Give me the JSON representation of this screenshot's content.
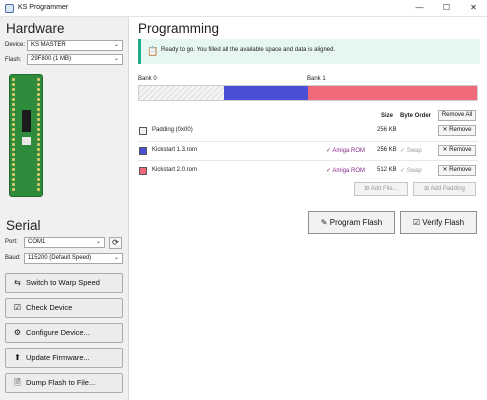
{
  "window": {
    "title": "KS Programmer",
    "controls": {
      "minimize": "—",
      "maximize": "☐",
      "close": "✕"
    }
  },
  "hardware": {
    "heading": "Hardware",
    "device_label": "Device:",
    "device_value": "KS MASTER",
    "flash_label": "Flash:",
    "flash_value": "29F800 (1 MB)"
  },
  "serial": {
    "heading": "Serial",
    "port_label": "Port:",
    "port_value": "COM1",
    "baud_label": "Baud:",
    "baud_value": "115200 (Default Speed)"
  },
  "buttons": {
    "warp": "Switch to Warp Speed",
    "check": "Check Device",
    "configure": "Configure Device...",
    "update": "Update Firmware...",
    "dump": "Dump Flash to File..."
  },
  "programming": {
    "heading": "Programming",
    "info": "Ready to go. You filled all the available space and data is aligned.",
    "bank0": "Bank 0",
    "bank1": "Bank 1",
    "col_size": "Size",
    "col_byte_order": "Byte Order",
    "remove_all": "Remove All",
    "rows": [
      {
        "name": "Padding (0x00)",
        "size": "256 KB",
        "color": "#f0f0f0",
        "amiga": "",
        "swap": "",
        "remove": "Remove"
      },
      {
        "name": "Kickstart 1.3.rom",
        "size": "256 KB",
        "color": "#4b4fd6",
        "amiga": "Amiga ROM",
        "swap": "Swap",
        "remove": "Remove"
      },
      {
        "name": "Kickstart 2.0.rom",
        "size": "512 KB",
        "color": "#f0697a",
        "amiga": "Amiga ROM",
        "swap": "Swap",
        "remove": "Remove"
      }
    ],
    "add_file": "Add File...",
    "add_padding": "Add Padding",
    "program_flash": "Program Flash",
    "verify_flash": "Verify Flash"
  },
  "colors": {
    "bank_padding": "#e4e4e4",
    "bank_ks13": "#4b4fd6",
    "bank_ks20": "#f0697a",
    "info_accent": "#1fae85"
  }
}
